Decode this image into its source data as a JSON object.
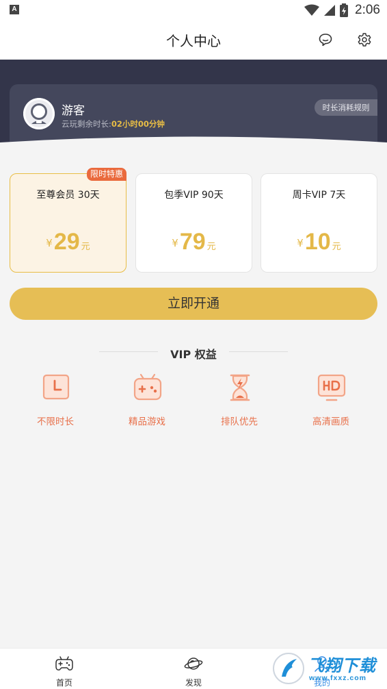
{
  "status_bar": {
    "time": "2:06",
    "notification_icon": "A"
  },
  "header": {
    "title": "个人中心",
    "icons": [
      "message-icon",
      "gear-icon"
    ]
  },
  "user": {
    "name": "游客",
    "remain_label": "云玩剩余时长:",
    "remain_value": "02小时00分钟",
    "rule_button": "时长消耗规则"
  },
  "plans": [
    {
      "name": "至尊会员 30天",
      "currency": "¥",
      "price": "29",
      "unit": "元",
      "tag": "限时特惠",
      "selected": true
    },
    {
      "name": "包季VIP 90天",
      "currency": "¥",
      "price": "79",
      "unit": "元"
    },
    {
      "name": "周卡VIP 7天",
      "currency": "¥",
      "price": "10",
      "unit": "元"
    }
  ],
  "open_button": "立即开通",
  "vip": {
    "title": "VIP 权益",
    "benefits": [
      {
        "label": "不限时长",
        "icon": "clock-icon"
      },
      {
        "label": "精品游戏",
        "icon": "gamepad-icon"
      },
      {
        "label": "排队优先",
        "icon": "hourglass-icon"
      },
      {
        "label": "高清画质",
        "icon": "hd-icon"
      }
    ]
  },
  "tabs": [
    {
      "label": "首页",
      "icon": "gamepad-icon"
    },
    {
      "label": "发现",
      "icon": "planet-icon"
    },
    {
      "label": "我的",
      "icon": "user-icon",
      "active": true
    }
  ],
  "watermark": {
    "text": "飞翔下载",
    "url": "www.fxxz.com"
  },
  "colors": {
    "accent": "#e6be55",
    "price": "#e4b848",
    "benefit": "#e8704a",
    "band": "#33354a",
    "tag": "#ea6a3d"
  }
}
